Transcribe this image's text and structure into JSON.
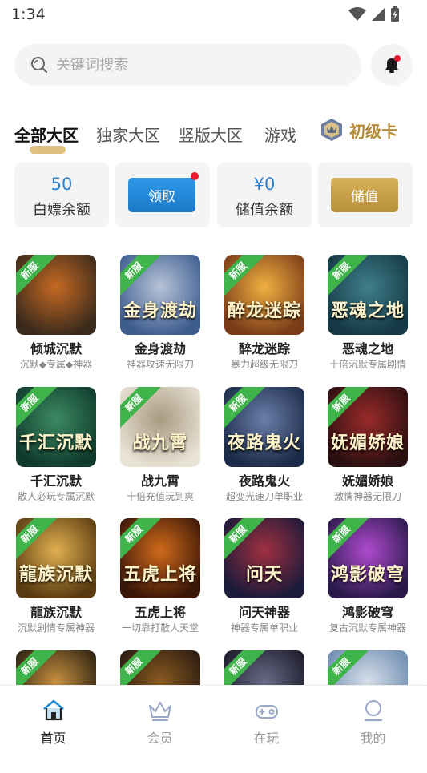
{
  "status": {
    "time": "1:34"
  },
  "search": {
    "placeholder": "关键词搜索"
  },
  "tabs": [
    {
      "label": "全部大区"
    },
    {
      "label": "独家大区"
    },
    {
      "label": "竖版大区"
    },
    {
      "label": "游戏"
    }
  ],
  "vip": {
    "label": "初级卡"
  },
  "cards": {
    "free": {
      "value": "50",
      "label": "白嫖余额"
    },
    "claim": {
      "button": "领取"
    },
    "deposit_balance": {
      "value": "¥0",
      "label": "储值余额"
    },
    "deposit": {
      "button": "储值"
    }
  },
  "badge": "新服",
  "games": [
    {
      "name": "倾城沉默",
      "desc": "沉默◆专属◆神器",
      "thumb_title": "",
      "colors": [
        "#3a2a1c",
        "#c56a23"
      ]
    },
    {
      "name": "金身渡劫",
      "desc": "神器攻速无限刀",
      "thumb_title": "金身渡劫",
      "colors": [
        "#3d5d8f",
        "#b7c4d8"
      ]
    },
    {
      "name": "醉龙迷踪",
      "desc": "暴力超级无限刀",
      "thumb_title": "醉龙迷踪",
      "colors": [
        "#7a3b18",
        "#f0b040"
      ]
    },
    {
      "name": "恶魂之地",
      "desc": "十倍沉默专属剧情",
      "thumb_title": "恶魂之地",
      "colors": [
        "#143844",
        "#3f7f8a"
      ]
    },
    {
      "name": "千汇沉默",
      "desc": "散人必玩专属沉默",
      "thumb_title": "千汇沉默",
      "colors": [
        "#0f3a2c",
        "#3c8a62"
      ]
    },
    {
      "name": "战九霄",
      "desc": "十倍充值玩到爽",
      "thumb_title": "战九霄",
      "colors": [
        "#e9e3d6",
        "#a89a80"
      ]
    },
    {
      "name": "夜路鬼火",
      "desc": "超变光速刀单职业",
      "thumb_title": "夜路鬼火",
      "colors": [
        "#1b2a48",
        "#6a7ea8"
      ]
    },
    {
      "name": "妩媚娇娘",
      "desc": "激情神器无限刀",
      "thumb_title": "妩媚娇娘",
      "colors": [
        "#2a0f10",
        "#9a2a2a"
      ]
    },
    {
      "name": "龍族沉默",
      "desc": "沉默剧情专属神器",
      "thumb_title": "龍族沉默",
      "colors": [
        "#5a3a10",
        "#e0b050"
      ]
    },
    {
      "name": "五虎上将",
      "desc": "一切靠打散人天堂",
      "thumb_title": "五虎上将",
      "colors": [
        "#3a1608",
        "#d06a1a"
      ]
    },
    {
      "name": "问天神器",
      "desc": "神器专属单职业",
      "thumb_title": "问天",
      "colors": [
        "#1a1a3a",
        "#a03040"
      ]
    },
    {
      "name": "鸿影破穹",
      "desc": "复古沉默专属神器",
      "thumb_title": "鸿影破穹",
      "colors": [
        "#2a1a4a",
        "#b04ad0"
      ]
    },
    {
      "name": "",
      "desc": "",
      "thumb_title": "",
      "colors": [
        "#2a2010",
        "#c89040"
      ]
    },
    {
      "name": "",
      "desc": "",
      "thumb_title": "",
      "colors": [
        "#2a1a10",
        "#8a5a20"
      ]
    },
    {
      "name": "",
      "desc": "",
      "thumb_title": "",
      "colors": [
        "#1a1a28",
        "#6a6a88"
      ]
    },
    {
      "name": "",
      "desc": "",
      "thumb_title": "",
      "colors": [
        "#6a8ab0",
        "#d8e0ea"
      ]
    }
  ],
  "nav": [
    {
      "label": "首页",
      "icon": "home-icon",
      "active": true
    },
    {
      "label": "会员",
      "icon": "crown-icon",
      "active": false
    },
    {
      "label": "在玩",
      "icon": "gamepad-icon",
      "active": false
    },
    {
      "label": "我的",
      "icon": "user-icon",
      "active": false
    }
  ],
  "colors": {
    "accent_blue": "#2a7fcf",
    "gold": "#b58a3a",
    "badge_green": "#3fb44a",
    "alert_red": "#e8192c"
  }
}
